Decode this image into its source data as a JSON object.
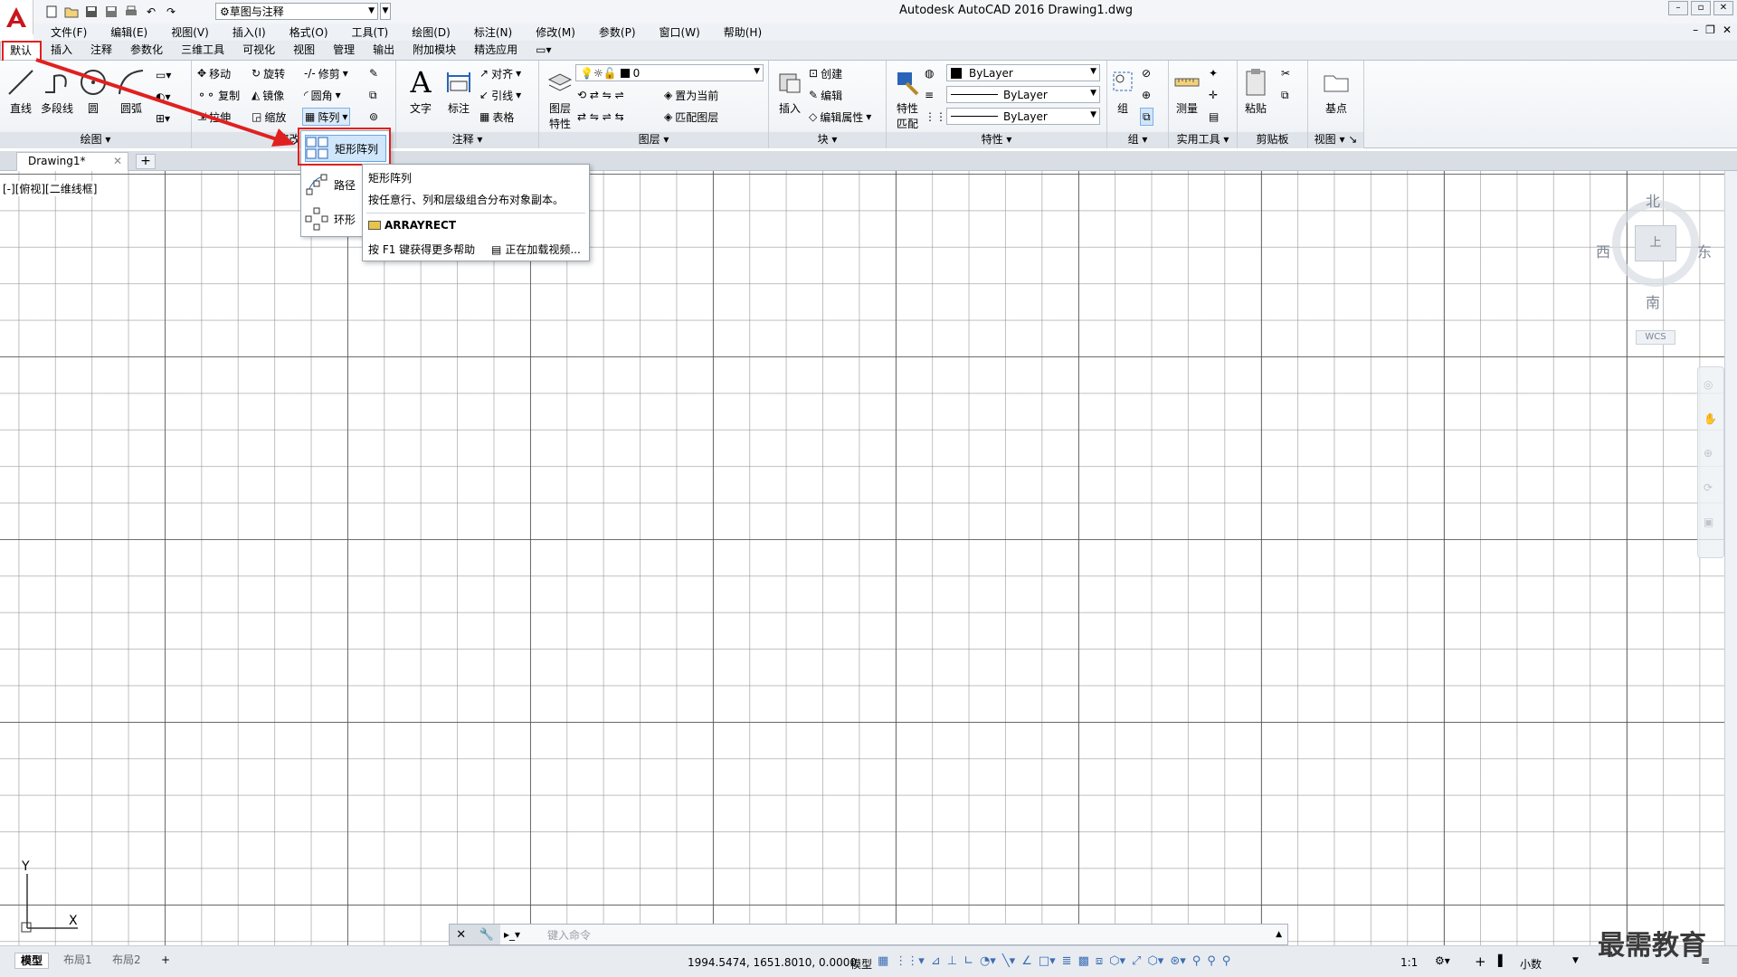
{
  "titlebar": {
    "workspace": "草图与注释",
    "app_title": "Autodesk AutoCAD 2016    Drawing1.dwg"
  },
  "menubar": {
    "items": [
      "文件(F)",
      "编辑(E)",
      "视图(V)",
      "插入(I)",
      "格式(O)",
      "工具(T)",
      "绘图(D)",
      "标注(N)",
      "修改(M)",
      "参数(P)",
      "窗口(W)",
      "帮助(H)"
    ]
  },
  "ribbon_tabs": [
    "默认",
    "插入",
    "注释",
    "参数化",
    "三维工具",
    "可视化",
    "视图",
    "管理",
    "输出",
    "附加模块",
    "精选应用"
  ],
  "ribbon": {
    "draw": {
      "title": "绘图",
      "line": "直线",
      "polyline": "多段线",
      "circle": "圆",
      "arc": "圆弧"
    },
    "modify": {
      "title": "修改",
      "move": "移动",
      "rotate": "旋转",
      "trim": "修剪",
      "copy": "复制",
      "mirror": "镜像",
      "fillet": "圆角",
      "stretch": "拉伸",
      "scale": "缩放",
      "array": "阵列"
    },
    "annotation": {
      "title": "注释",
      "text": "文字",
      "dimension": "标注",
      "align": "对齐",
      "leader": "引线",
      "table": "表格"
    },
    "layers": {
      "title": "图层",
      "properties_line1": "图层",
      "properties_line2": "特性",
      "current_layer": "0",
      "set_current": "置为当前",
      "match_layer": "匹配图层"
    },
    "block": {
      "title": "块",
      "insert": "插入",
      "create": "创建",
      "edit": "编辑",
      "edit_attributes": "编辑属性"
    },
    "properties": {
      "title": "特性",
      "match_line1": "特性",
      "match_line2": "匹配",
      "color": "ByLayer",
      "linetype": "ByLayer",
      "lineweight": "ByLayer"
    },
    "groups": {
      "title": "组",
      "group": "组"
    },
    "utilities": {
      "title": "实用工具",
      "measure": "测量"
    },
    "clipboard": {
      "title": "剪贴板",
      "paste": "粘贴"
    },
    "view": {
      "title": "视图",
      "base": "基点"
    }
  },
  "array_flyout": {
    "rect": "矩形阵列",
    "path": "路径",
    "polar": "环形"
  },
  "tooltip": {
    "title": "矩形阵列",
    "description": "按任意行、列和层级组合分布对象副本。",
    "command": "ARRAYRECT",
    "help": "按 F1 键获得更多帮助",
    "video": "正在加载视频..."
  },
  "doc_tabs": {
    "active": "Drawing1*"
  },
  "viewport_label": "[-][俯视][二维线框]",
  "viewcube": {
    "north": "北",
    "south": "南",
    "east": "东",
    "west": "西",
    "top_face": "上",
    "wcs": "WCS"
  },
  "ucs": {
    "x": "X",
    "y": "Y"
  },
  "command_line": {
    "placeholder": "键入命令"
  },
  "layout_tabs": [
    "模型",
    "布局1",
    "布局2"
  ],
  "status": {
    "coords": "1994.5474, 1651.8010, 0.0000",
    "space": "模型",
    "scale": "1:1",
    "units": "小数"
  },
  "watermark": "最需教育",
  "colors": {
    "highlight_red": "#e02020",
    "autocad_red": "#c8161d",
    "grid": "#8c8c8c"
  }
}
